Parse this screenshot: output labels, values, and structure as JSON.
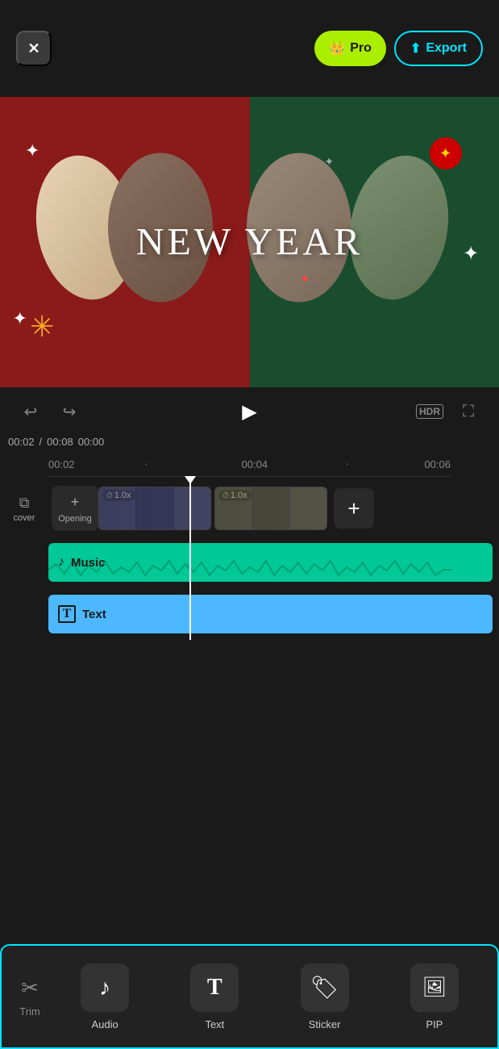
{
  "header": {
    "close_label": "✕",
    "pro_label": "Pro",
    "pro_icon": "👑",
    "export_label": "Export",
    "export_icon": "⬆"
  },
  "preview": {
    "title": "NEW YEAR"
  },
  "playback": {
    "undo_icon": "↩",
    "redo_icon": "↪",
    "play_icon": "▶",
    "hdr_label": "HDR",
    "fullscreen_icon": "⛶"
  },
  "timeline": {
    "current_time": "00:02",
    "total_time": "00:08",
    "offset_time": "00:00",
    "markers": [
      "00:02",
      "00:04",
      "00:06"
    ],
    "cover_label": "cover",
    "opening_plus_icon": "+",
    "opening_label": "Opening",
    "speed_label_1": "①1.0x",
    "speed_label_2": "①1.0x",
    "add_clip_icon": "+",
    "music_icon": "♪",
    "music_label": "Music",
    "text_icon": "T",
    "text_label": "Text"
  },
  "toolbar": {
    "trim_icon": "✂",
    "trim_label": "Trim",
    "audio_icon": "♪",
    "audio_label": "Audio",
    "text_icon": "T",
    "text_label": "Text",
    "sticker_icon": "◕",
    "sticker_label": "Sticker",
    "pip_icon": "🖼",
    "pip_label": "PIP"
  },
  "colors": {
    "accent_cyan": "#00e5ff",
    "accent_green": "#aaee00",
    "music_track": "#00c896",
    "text_track": "#4db8ff",
    "bg_dark": "#1a1a1a",
    "bg_medium": "#222222"
  }
}
